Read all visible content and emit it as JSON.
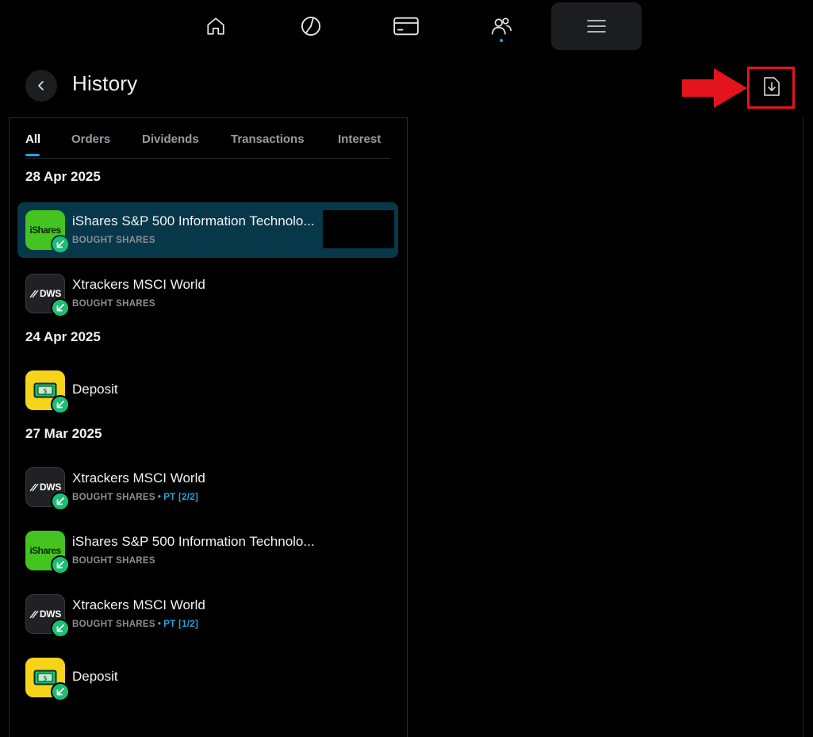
{
  "colors": {
    "accent": "#1fa5dd",
    "badge_green": "#1cbf73",
    "selected_row": "#06384a",
    "annotation_red": "#e3141b"
  },
  "nav": {
    "items": [
      {
        "icon": "home-icon"
      },
      {
        "icon": "pie-chart-icon"
      },
      {
        "icon": "card-icon"
      },
      {
        "icon": "people-icon"
      },
      {
        "icon": "menu-icon"
      }
    ]
  },
  "header": {
    "title": "History",
    "back_icon": "chevron-left-icon",
    "download_icon": "download-document-icon"
  },
  "tabs": [
    "All",
    "Orders",
    "Dividends",
    "Transactions",
    "Interest"
  ],
  "groups": [
    {
      "date": "28 Apr 2025",
      "items": [
        {
          "title": "iShares S&P 500 Information Technolo...",
          "subtitle": "BOUGHT SHARES",
          "logo": "iShares",
          "logo_type": "ishares",
          "selected": true
        },
        {
          "title": "Xtrackers MSCI World",
          "subtitle": "BOUGHT SHARES",
          "logo": "DWS",
          "logo_type": "dws"
        }
      ]
    },
    {
      "date": "24 Apr 2025",
      "items": [
        {
          "title": "Deposit",
          "logo_type": "deposit"
        }
      ]
    },
    {
      "date": "27 Mar 2025",
      "items": [
        {
          "title": "Xtrackers MSCI World",
          "subtitle": "BOUGHT SHARES",
          "tag": "PT [2/2]",
          "logo": "DWS",
          "logo_type": "dws"
        },
        {
          "title": "iShares S&P 500 Information Technolo...",
          "subtitle": "BOUGHT SHARES",
          "logo": "iShares",
          "logo_type": "ishares"
        },
        {
          "title": "Xtrackers MSCI World",
          "subtitle": "BOUGHT SHARES",
          "tag": "PT [1/2]",
          "logo": "DWS",
          "logo_type": "dws"
        },
        {
          "title": "Deposit",
          "logo_type": "deposit"
        }
      ]
    }
  ]
}
